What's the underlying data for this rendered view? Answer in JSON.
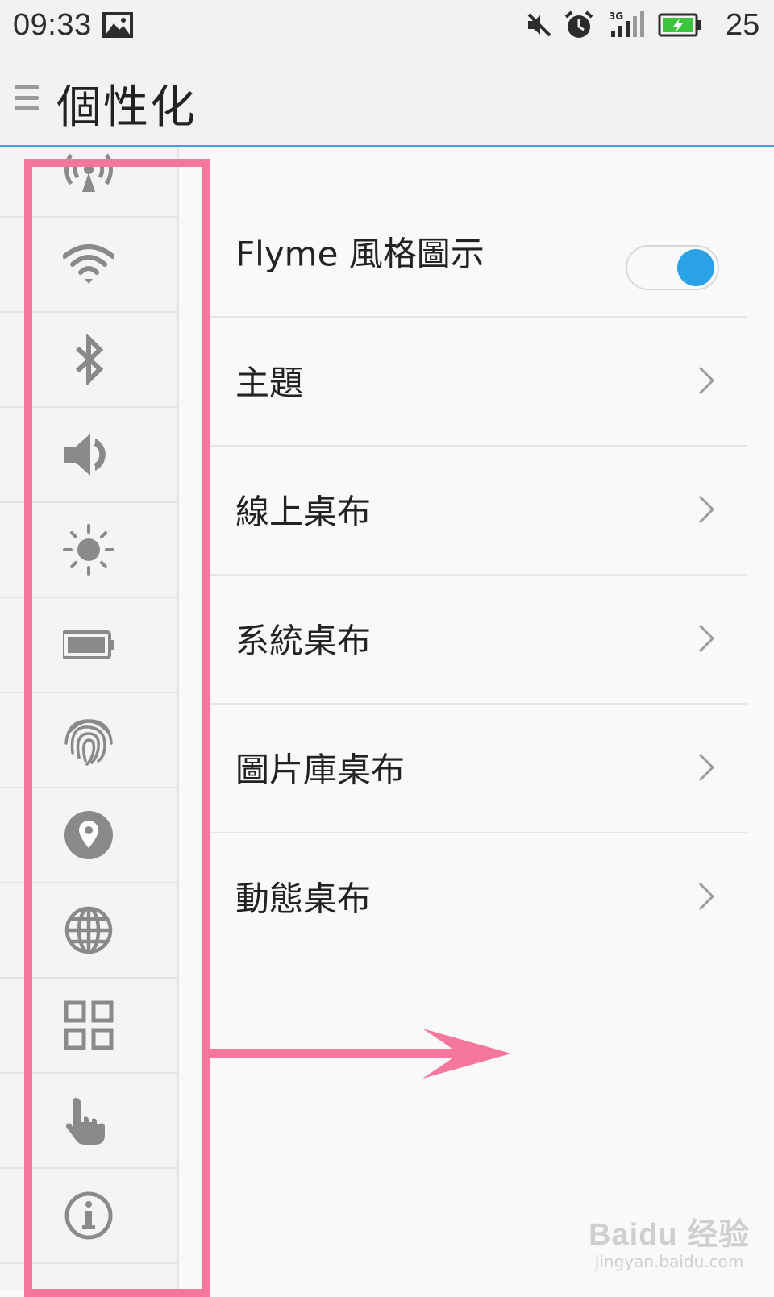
{
  "status_bar": {
    "time": "09:33",
    "battery_level": "25",
    "icons": [
      "image-icon",
      "mute-icon",
      "alarm-icon",
      "3g-signal-icon",
      "battery-charging-icon"
    ]
  },
  "header": {
    "title": "個性化",
    "menu_icon": "menu-icon"
  },
  "sidebar": {
    "items": [
      {
        "icon": "hotspot-icon"
      },
      {
        "icon": "wifi-icon"
      },
      {
        "icon": "bluetooth-icon"
      },
      {
        "icon": "volume-icon"
      },
      {
        "icon": "brightness-icon"
      },
      {
        "icon": "battery-icon"
      },
      {
        "icon": "fingerprint-icon"
      },
      {
        "icon": "location-icon"
      },
      {
        "icon": "globe-icon"
      },
      {
        "icon": "apps-grid-icon"
      },
      {
        "icon": "hand-gesture-icon"
      },
      {
        "icon": "info-icon"
      }
    ]
  },
  "settings": {
    "items": [
      {
        "label": "Flyme 風格圖示",
        "control": "toggle",
        "toggle_on": true
      },
      {
        "label": "主題",
        "control": "chevron"
      },
      {
        "label": "線上桌布",
        "control": "chevron"
      },
      {
        "label": "系統桌布",
        "control": "chevron"
      },
      {
        "label": "圖片庫桌布",
        "control": "chevron"
      },
      {
        "label": "動態桌布",
        "control": "chevron"
      }
    ]
  },
  "annotation": {
    "highlight_color": "#f5779b"
  },
  "watermark": {
    "brand": "Baidu 经验",
    "url": "jingyan.baidu.com"
  },
  "colors": {
    "accent": "#29a2e8",
    "icon_gray": "#8a8a8a"
  }
}
